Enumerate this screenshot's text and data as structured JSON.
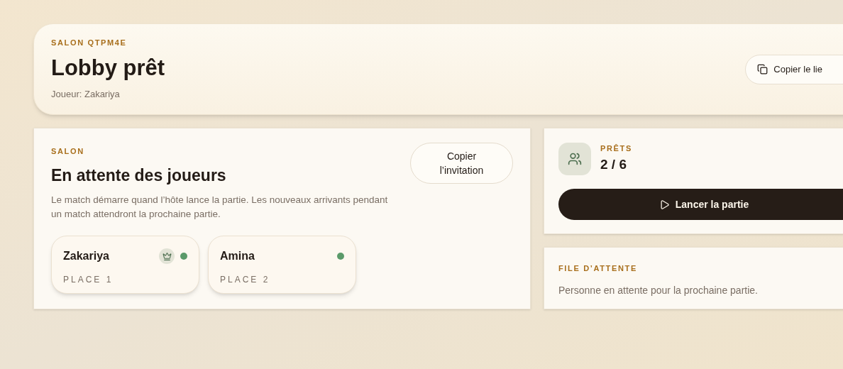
{
  "header": {
    "eyebrow": "SALON QTPM4E",
    "title": "Lobby prêt",
    "subtitle": "Joueur: Zakariya",
    "copy_link_button": "Copier le lie"
  },
  "lobby": {
    "eyebrow": "SALON",
    "title": "En attente des joueurs",
    "description": "Le match démarre quand l’hôte lance la partie. Les nouveaux arrivants pendant un match attendront la prochaine partie.",
    "invite_button": "Copier l’invitation",
    "players": [
      {
        "name": "Zakariya",
        "place": "PLACE 1",
        "host": true,
        "online": true
      },
      {
        "name": "Amina",
        "place": "PLACE 2",
        "host": false,
        "online": true
      }
    ]
  },
  "ready": {
    "label": "PRÊTS",
    "count": "2 / 6",
    "start_button": "Lancer la partie"
  },
  "queue": {
    "label": "FILE D’ATTENTE",
    "message": "Personne en attente pour la prochaine partie."
  }
}
